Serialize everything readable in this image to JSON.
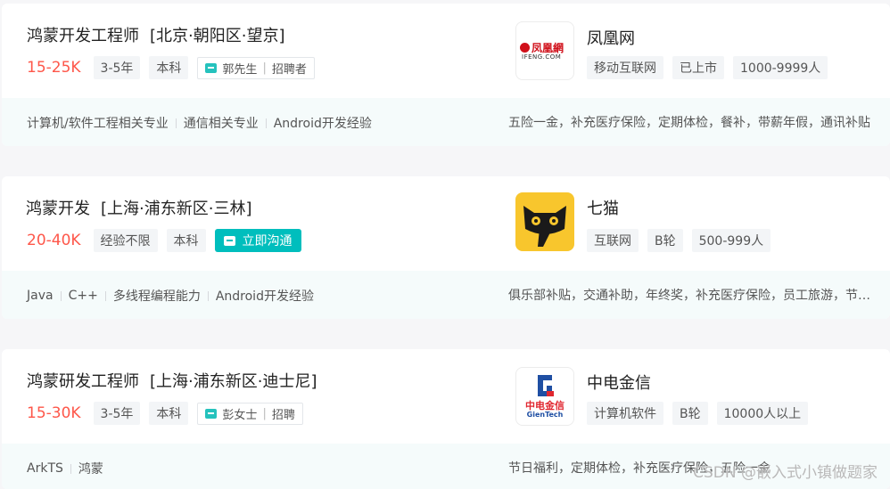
{
  "jobs": [
    {
      "title": "鸿蒙开发工程师",
      "location": "[北京·朝阳区·望京]",
      "salary": "15-25K",
      "tags": [
        "3-5年",
        "本科"
      ],
      "recruiter_name": "郭先生",
      "recruiter_role": "招聘者",
      "skills": [
        "计算机/软件工程相关专业",
        "通信相关专业",
        "Android开发经验"
      ],
      "welfare": "五险一金，补充医疗保险，定期体检，餐补，带薪年假，通讯补贴",
      "company": {
        "name": "凤凰网",
        "logo_text": "凤凰網",
        "logo_subtext": "IFENG.COM",
        "tags": [
          "移动互联网",
          "已上市",
          "1000-9999人"
        ]
      }
    },
    {
      "title": "鸿蒙开发",
      "location": "[上海·浦东新区·三林]",
      "salary": "20-40K",
      "tags": [
        "经验不限",
        "本科"
      ],
      "chat_label": "立即沟通",
      "skills": [
        "Java",
        "C++",
        "多线程编程能力",
        "Android开发经验"
      ],
      "welfare": "俱乐部补贴，交通补助，年终奖，补充医疗保险，员工旅游，节日福利",
      "company": {
        "name": "七猫",
        "tags": [
          "互联网",
          "B轮",
          "500-999人"
        ]
      }
    },
    {
      "title": "鸿蒙研发工程师",
      "location": "[上海·浦东新区·迪士尼]",
      "salary": "15-30K",
      "tags": [
        "3-5年",
        "本科"
      ],
      "recruiter_name": "彭女士",
      "recruiter_role": "招聘",
      "skills": [
        "ArkTS",
        "鸿蒙"
      ],
      "welfare": "节日福利，定期体检，补充医疗保险，五险一金",
      "company": {
        "name": "中电金信",
        "logo_text": "中电金信",
        "logo_subtext": "GienTech",
        "tags": [
          "计算机软件",
          "B轮",
          "10000人以上"
        ]
      }
    }
  ],
  "watermark": "CSDN @嵌入式小镇做题家",
  "colors": {
    "salary": "#fe574a",
    "accent": "#00bebd",
    "footer_bg": "#f5fbfb"
  }
}
